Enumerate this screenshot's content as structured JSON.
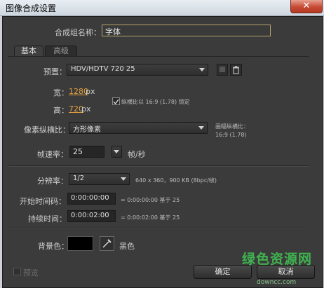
{
  "window": {
    "title": "图像合成设置",
    "close_glyph": "✕"
  },
  "comp_name": {
    "label": "合成组名称：",
    "value": "字体"
  },
  "tabs": [
    {
      "label": "基本"
    },
    {
      "label": "高级"
    }
  ],
  "preset": {
    "label": "预置：",
    "value": "HDV/HDTV 720 25"
  },
  "size": {
    "width_label": "宽：",
    "width_value": "1280",
    "width_unit": "px",
    "height_label": "高：",
    "height_value": "720",
    "height_unit": "px",
    "lock_label": "纵横比以 16:9 (1.78) 锁定",
    "lock_checked": true
  },
  "pixel_aspect": {
    "label": "像素纵横比：",
    "value": "方形像素",
    "frame_aspect_label": "画幅纵横比：",
    "frame_aspect_value": "16:9 (1.78)"
  },
  "frame_rate": {
    "label": "帧速率：",
    "value": "25",
    "unit": "帧/秒"
  },
  "resolution": {
    "label": "分辨率：",
    "value": "1/2",
    "info": "640 x 360，900 KB (8bpc/帧)"
  },
  "start_timecode": {
    "label": "开始时间码：",
    "value": "0:00:00:00",
    "info": "= 0:00:00:00  基于 25"
  },
  "duration": {
    "label": "持续时间：",
    "value": "0:00:02:00",
    "info": "= 0:00:02:00  基于 25"
  },
  "background": {
    "label": "背景色：",
    "color": "#000000",
    "color_name": "黑色"
  },
  "footer": {
    "preview_label": "预览",
    "ok_label": "确定",
    "cancel_label": "取消"
  },
  "watermark": {
    "text": "绿色资源网",
    "url": "downcc.com"
  }
}
